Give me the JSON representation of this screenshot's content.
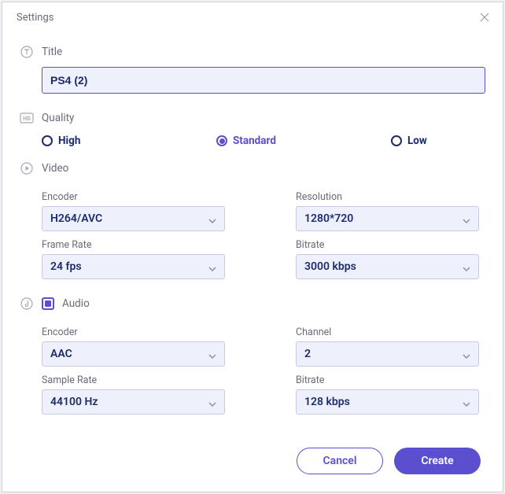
{
  "window": {
    "title": "Settings"
  },
  "title": {
    "label": "Title",
    "value": "PS4 (2)"
  },
  "quality": {
    "label": "Quality",
    "high": "High",
    "standard": "Standard",
    "low": "Low",
    "selected": "standard"
  },
  "video": {
    "label": "Video",
    "encoder": {
      "label": "Encoder",
      "value": "H264/AVC"
    },
    "resolution": {
      "label": "Resolution",
      "value": "1280*720"
    },
    "frame_rate": {
      "label": "Frame Rate",
      "value": "24 fps"
    },
    "bitrate": {
      "label": "Bitrate",
      "value": "3000 kbps"
    }
  },
  "audio": {
    "label": "Audio",
    "enabled": true,
    "encoder": {
      "label": "Encoder",
      "value": "AAC"
    },
    "channel": {
      "label": "Channel",
      "value": "2"
    },
    "sample_rate": {
      "label": "Sample Rate",
      "value": "44100 Hz"
    },
    "bitrate": {
      "label": "Bitrate",
      "value": "128 kbps"
    }
  },
  "buttons": {
    "cancel": "Cancel",
    "create": "Create"
  }
}
